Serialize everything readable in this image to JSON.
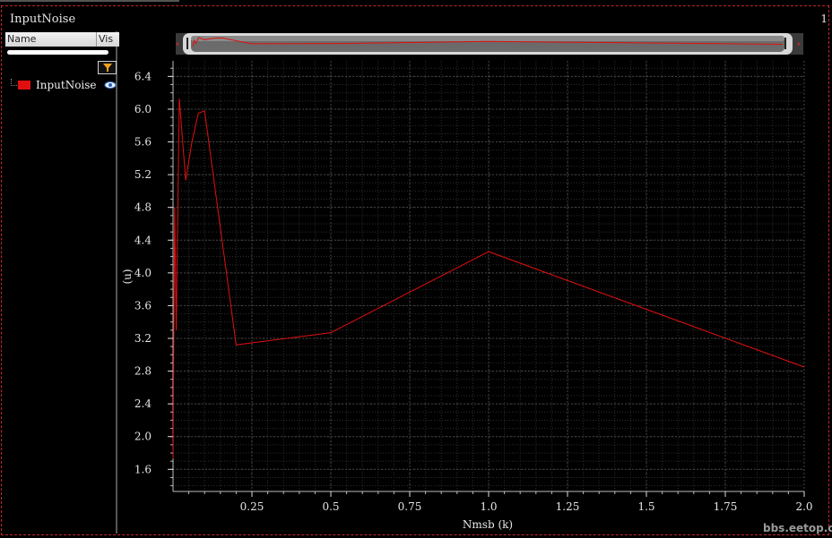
{
  "window": {
    "title": "InputNoise",
    "index": "1"
  },
  "trace_list": {
    "columns": [
      "Name",
      "Vis"
    ],
    "items": [
      {
        "label": "InputNoise",
        "color": "#e01010"
      }
    ]
  },
  "watermark": "bbs.eetop.cn",
  "chart_data": {
    "type": "line",
    "xlabel": "Nmsb (k)",
    "ylabel": "(u)",
    "xlim": [
      0.0,
      2.0
    ],
    "ylim": [
      1.33,
      6.59
    ],
    "x_ticks": [
      0.25,
      0.5,
      0.75,
      1.0,
      1.25,
      1.5,
      1.75,
      2.0
    ],
    "x_tick_labels": [
      "0.25",
      "0.5",
      "0.75",
      "1.0",
      "1.25",
      "1.5",
      "1.75",
      "2.0"
    ],
    "y_ticks": [
      1.6,
      2.0,
      2.4,
      2.8,
      3.2,
      3.6,
      4.0,
      4.4,
      4.8,
      5.2,
      5.6,
      6.0,
      6.4
    ],
    "y_tick_labels": [
      "1.6",
      "2.0",
      "2.4",
      "2.8",
      "3.2",
      "3.6",
      "4.0",
      "4.4",
      "4.8",
      "5.2",
      "5.6",
      "6.0",
      "6.4"
    ],
    "grid": true,
    "series": [
      {
        "name": "InputNoise",
        "color": "#e01010",
        "x": [
          0.0,
          0.005,
          0.01,
          0.02,
          0.04,
          0.06,
          0.08,
          0.1,
          0.2,
          0.5,
          1.0,
          2.0
        ],
        "y": [
          1.73,
          4.8,
          3.3,
          6.13,
          5.13,
          5.6,
          5.95,
          5.98,
          3.12,
          3.27,
          4.26,
          2.85
        ]
      }
    ]
  }
}
